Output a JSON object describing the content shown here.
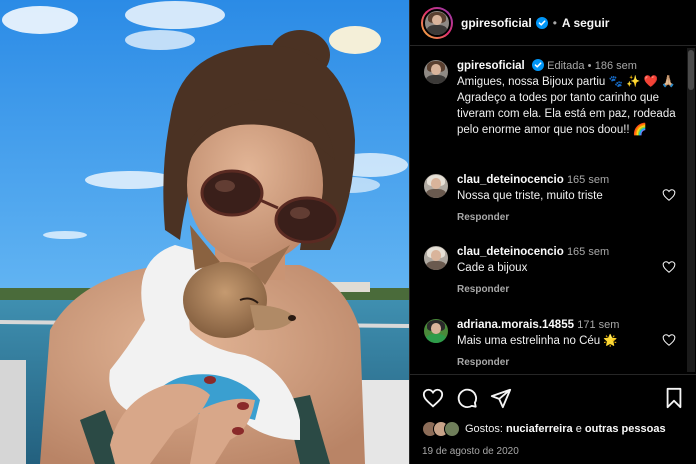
{
  "post": {
    "photo_alt": "",
    "header": {
      "username": "gpiresoficial",
      "separator": "•",
      "follow_label": "A seguir"
    },
    "caption": {
      "username": "gpiresoficial",
      "edited": "Editada",
      "separator": "•",
      "time": "186 sem",
      "text": "Amigues, nossa Bijoux partiu 🐾 ✨ ❤️ 🙏🏼 Agradeço a todes por tanto carinho que tiveram com ela. Ela está em paz, rodeada pelo enorme amor que nos doou!! 🌈"
    },
    "comments": [
      {
        "username": "clau_deteinocencio",
        "time": "165 sem",
        "text": "Nossa que triste, muito triste",
        "reply_label": "Responder"
      },
      {
        "username": "clau_deteinocencio",
        "time": "165 sem",
        "text": "Cade a bijoux",
        "reply_label": "Responder"
      },
      {
        "username": "adriana.morais.14855",
        "time": "171 sem",
        "text": "Mais uma estrelinha no Céu 🌟",
        "reply_label": "Responder"
      }
    ],
    "actions": {
      "like_icon": "heart-icon",
      "comment_icon": "comment-icon",
      "share_icon": "send-icon",
      "save_icon": "bookmark-icon"
    },
    "likes": {
      "prefix": "Gostos:",
      "user": "nuciaferreira",
      "connector": "e",
      "others": "outras pessoas"
    },
    "date": "19 de agosto de 2020",
    "colors": {
      "background": "#000000",
      "text": "#f5f5f5",
      "muted": "#a8a8a8",
      "verified": "#0095f6"
    }
  }
}
